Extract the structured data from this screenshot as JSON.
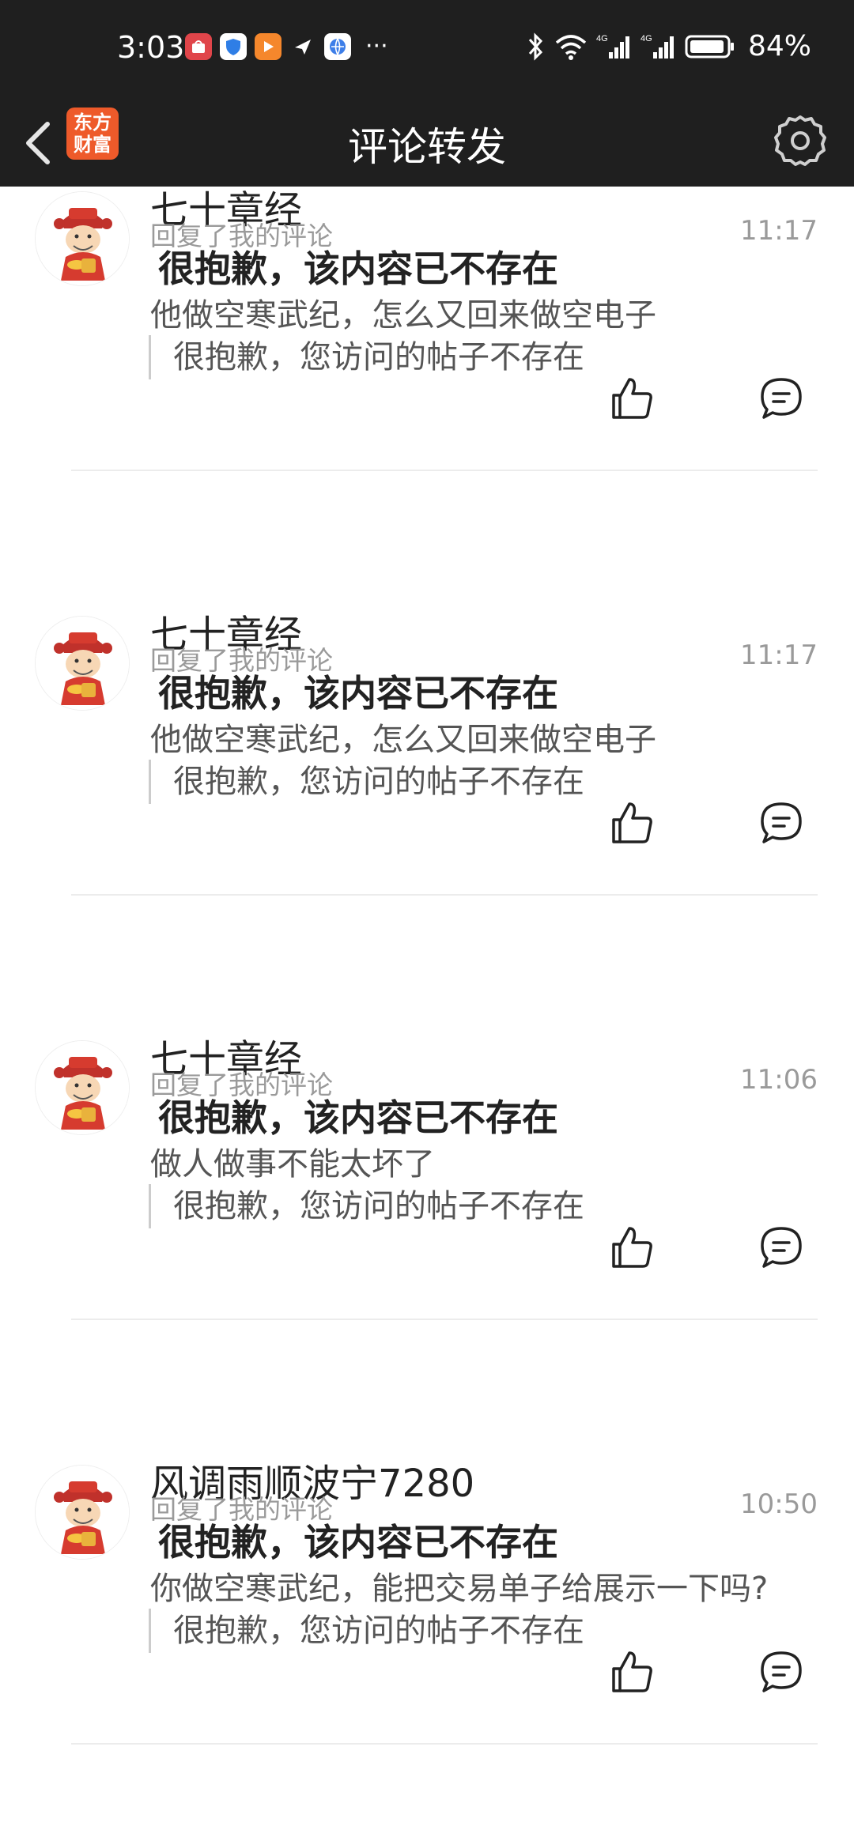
{
  "status_bar": {
    "time": "3:03",
    "battery_percent": "84%",
    "app_icons": [
      "huawei-store-icon",
      "security-shield-icon",
      "video-player-icon",
      "paper-plane-icon",
      "browser-globe-icon"
    ],
    "more": "···"
  },
  "nav": {
    "title": "评论转发",
    "logo_line1": "东方",
    "logo_line2": "财富"
  },
  "colors": {
    "brand": "#ee5a2a",
    "header_bg": "#1f1f1f"
  },
  "items": [
    {
      "name": "七十章经",
      "subtitle": "回复了我的评论",
      "time": "11:17",
      "headline": "很抱歉，该内容已不存在",
      "body": "他做空寒武纪，怎么又回来做空电子",
      "quote": "很抱歉，您访问的帖子不存在"
    },
    {
      "name": "七十章经",
      "subtitle": "回复了我的评论",
      "time": "11:17",
      "headline": "很抱歉，该内容已不存在",
      "body": "他做空寒武纪，怎么又回来做空电子",
      "quote": "很抱歉，您访问的帖子不存在"
    },
    {
      "name": "七十章经",
      "subtitle": "回复了我的评论",
      "time": "11:06",
      "headline": "很抱歉，该内容已不存在",
      "body": "做人做事不能太坏了",
      "quote": "很抱歉，您访问的帖子不存在"
    },
    {
      "name": "风调雨顺波宁7280",
      "subtitle": "回复了我的评论",
      "time": "10:50",
      "headline": "很抱歉，该内容已不存在",
      "body": "你做空寒武纪，能把交易单子给展示一下吗?",
      "quote": "很抱歉，您访问的帖子不存在"
    }
  ]
}
